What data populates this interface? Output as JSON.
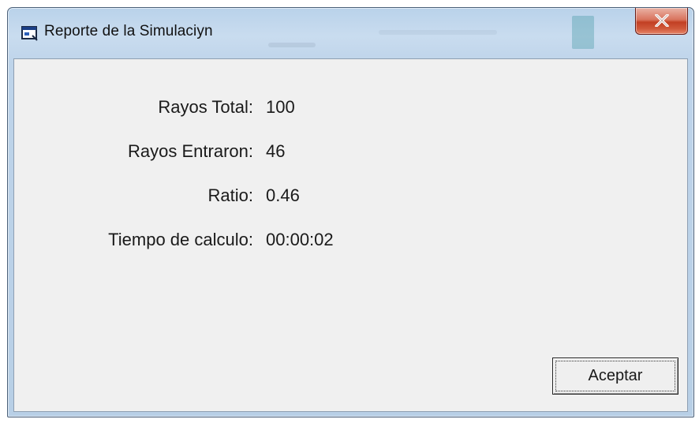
{
  "window": {
    "title": "Reporte de la Simulaciyn"
  },
  "report": {
    "rows": [
      {
        "label": "Rayos Total:",
        "value": "100"
      },
      {
        "label": "Rayos Entraron:",
        "value": "46"
      },
      {
        "label": "Ratio:",
        "value": "0.46"
      },
      {
        "label": "Tiempo de calculo:",
        "value": "00:00:02"
      }
    ]
  },
  "buttons": {
    "accept_label": "Aceptar"
  },
  "icons": {
    "title": "app-window-icon",
    "close": "close-icon"
  },
  "colors": {
    "client_background": "#f0f0f0",
    "close_button": "#c23f23",
    "frame": "#bed4ea"
  }
}
